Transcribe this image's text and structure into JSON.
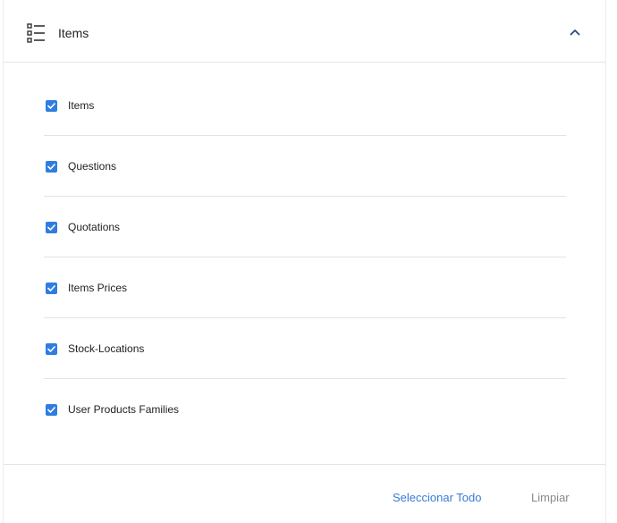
{
  "header": {
    "title": "Items",
    "icon": "list-icon",
    "collapse_icon": "chevron-up-icon"
  },
  "items": [
    {
      "label": "Items",
      "checked": true
    },
    {
      "label": "Questions",
      "checked": true
    },
    {
      "label": "Quotations",
      "checked": true
    },
    {
      "label": "Items Prices",
      "checked": true
    },
    {
      "label": "Stock-Locations",
      "checked": true
    },
    {
      "label": "User Products Families",
      "checked": true
    }
  ],
  "footer": {
    "select_all_label": "Seleccionar Todo",
    "clear_label": "Limpiar"
  },
  "colors": {
    "accent": "#2f7de1",
    "link": "#3a7bd5",
    "muted": "#8a8a8a"
  }
}
